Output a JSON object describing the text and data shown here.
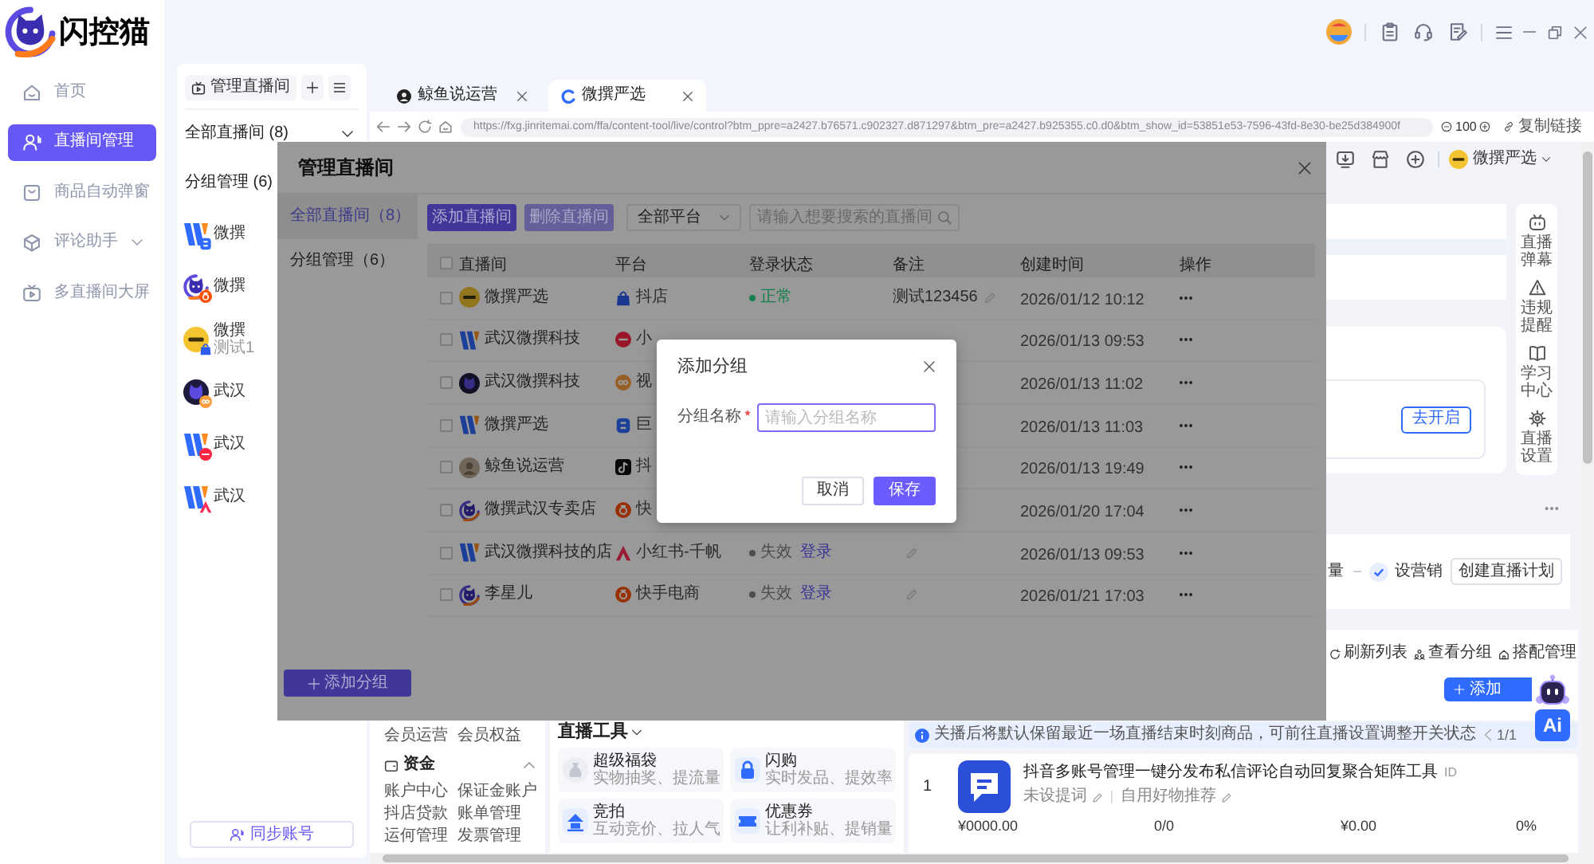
{
  "app": {
    "name": "闪控猫"
  },
  "nav": [
    {
      "label": "首页",
      "kind": "home",
      "selected": false
    },
    {
      "label": "直播间管理",
      "kind": "user",
      "selected": true
    },
    {
      "label": "商品自动弹窗",
      "kind": "box",
      "selected": false
    },
    {
      "label": "评论助手",
      "kind": "cube",
      "selected": false,
      "expandable": true
    },
    {
      "label": "多直播间大屏",
      "kind": "tv",
      "selected": false
    }
  ],
  "panel": {
    "manage_button": "管理直播间",
    "filters": [
      {
        "label": "全部直播间 (8)",
        "expandable": true
      },
      {
        "label": "分组管理 (6)"
      }
    ],
    "accounts": [
      {
        "name": "微撰",
        "avatar": {
          "kind": "stripes"
        },
        "platform": {
          "kind": "letter"
        }
      },
      {
        "name": "微撰",
        "avatar": {
          "kind": "logo"
        },
        "platform": {
          "kind": "camera"
        }
      },
      {
        "name": "微撰",
        "note": "测试1",
        "avatar": {
          "kind": "badge"
        },
        "platform": {
          "kind": "bag"
        }
      },
      {
        "name": "武汉",
        "avatar": {
          "kind": "cat"
        },
        "platform": {
          "kind": "knot"
        }
      },
      {
        "name": "武汉",
        "avatar": {
          "kind": "stripes"
        },
        "platform": {
          "kind": "disc"
        }
      },
      {
        "name": "武汉",
        "avatar": {
          "kind": "stripes"
        },
        "platform": {
          "kind": "peak"
        }
      }
    ],
    "sync_button": "同步账号"
  },
  "browser": {
    "tabs": [
      {
        "label": "鲸鱼说运营",
        "favicon": {
          "kind": "avatar"
        },
        "selected": false
      },
      {
        "label": "微撰严选",
        "favicon": {
          "kind": "swirl"
        },
        "selected": true
      }
    ],
    "url": "https://fxg.jinritemai.com/ffa/content-tool/live/control?btm_ppre=a2427.b76571.c902327.d871297&btm_pre=a2427.b925355.c0.d0&btm_show_id=53851e53-7596-43fd-8e30-be25d384900f",
    "zoom": "100",
    "copy_link": "复制链接"
  },
  "live_page": {
    "shop_name": "微撰严选",
    "side_tools": [
      {
        "label": "直播弹幕",
        "kind": "screen"
      },
      {
        "label": "违规提醒",
        "kind": "warning"
      },
      {
        "label": "学习中心",
        "kind": "book"
      },
      {
        "label": "直播设置",
        "kind": "gear"
      }
    ],
    "enable_button": "去开启",
    "plan_bar": {
      "steps": [
        {
          "label": "量",
          "done": false
        },
        {
          "label": "设营销",
          "done": true
        }
      ],
      "create_button": "创建直播计划"
    },
    "list_actions": [
      {
        "label": "刷新列表",
        "kind": "refresh"
      },
      {
        "label": "查看分组",
        "kind": "people"
      },
      {
        "label": "搭配管理",
        "kind": "house"
      }
    ],
    "add_button": "添加",
    "assistant": "Ai",
    "menu": {
      "rows": [
        [
          "会员运营",
          "会员权益"
        ]
      ],
      "section": {
        "label": "资金",
        "expanded": true
      },
      "links": [
        [
          "账户中心",
          "保证金账户"
        ],
        [
          "抖店贷款",
          "账单管理"
        ],
        [
          "运何管理",
          "发票管理"
        ]
      ]
    },
    "tools": {
      "title": "直播工具",
      "cards": [
        {
          "title": "超级福袋",
          "description": "实物抽奖、提流量",
          "kind": "pouch"
        },
        {
          "title": "闪购",
          "description": "实时发品、提效率",
          "kind": "lock"
        },
        {
          "title": "竞拍",
          "description": "互动竞价、拉人气",
          "kind": "house"
        },
        {
          "title": "优惠券",
          "description": "让利补贴、提销量",
          "kind": "ticket"
        }
      ]
    },
    "products": {
      "notice": "关播后将默认保留最近一场直播结束时刻商品，可前往直播设置调整开关状态",
      "pager": "1/1",
      "items": [
        {
          "index": "1",
          "title": "抖音多账号管理一键分发布私信评论自动回复聚合矩阵工具",
          "id_label": "ID",
          "tags": [
            "未设提词",
            "自用好物推荐"
          ],
          "stats": [
            "¥0000.00",
            "0/0",
            "¥0.00",
            "0%"
          ]
        }
      ]
    }
  },
  "manage_dialog": {
    "title": "管理直播间",
    "side": [
      {
        "label": "全部直播间（8）",
        "selected": true
      },
      {
        "label": "分组管理（6）",
        "selected": false
      }
    ],
    "add_group_button": "添加分组",
    "add_button": "添加直播间",
    "delete_button": {
      "label": "删除直播间",
      "disabled": true
    },
    "platform_select": "全部平台",
    "search": {
      "placeholder": "请输入想要搜索的直播间"
    },
    "table": {
      "all_checked": false,
      "columns": [
        "直播间",
        "平台",
        "登录状态",
        "备注",
        "创建时间",
        "操作"
      ],
      "rows": [
        {
          "checked": false,
          "avatar": {
            "kind": "badge"
          },
          "name": "微撰严选",
          "platform": {
            "kind": "bag",
            "label": "抖店"
          },
          "status": {
            "label": "正常",
            "color": "#17804c"
          },
          "remark": "测试123456",
          "editable": true,
          "created": "2026/01/12 10:12"
        },
        {
          "checked": false,
          "avatar": {
            "kind": "stripes"
          },
          "name": "武汉微撰科技",
          "platform": {
            "kind": "disc",
            "label": "小"
          },
          "created": "2026/01/13 09:53"
        },
        {
          "checked": false,
          "avatar": {
            "kind": "cat"
          },
          "name": "武汉微撰科技",
          "platform": {
            "kind": "knot",
            "label": "视"
          },
          "created": "2026/01/13 11:02"
        },
        {
          "checked": false,
          "avatar": {
            "kind": "stripes"
          },
          "name": "微撰严选",
          "platform": {
            "kind": "letter",
            "label": "巨"
          },
          "created": "2026/01/13 11:03"
        },
        {
          "checked": false,
          "avatar": {
            "kind": "photo"
          },
          "name": "鲸鱼说运营",
          "platform": {
            "kind": "note",
            "label": "抖"
          },
          "created": "2026/01/13 19:49"
        },
        {
          "checked": false,
          "avatar": {
            "kind": "logo"
          },
          "name": "微撰武汉专卖店",
          "platform": {
            "kind": "camera",
            "label": "快"
          },
          "created": "2026/01/20 17:04"
        },
        {
          "checked": false,
          "avatar": {
            "kind": "stripes"
          },
          "name": "武汉微撰科技的店",
          "platform": {
            "kind": "peak",
            "label": "小红书-千帆"
          },
          "status": {
            "label": "失效",
            "color": "#4d4d4d"
          },
          "login_link": "登录",
          "editable": true,
          "created": "2026/01/13 09:53"
        },
        {
          "checked": false,
          "avatar": {
            "kind": "logo"
          },
          "name": "李星儿",
          "platform": {
            "kind": "camera",
            "label": "快手电商"
          },
          "status": {
            "label": "失效",
            "color": "#4d4d4d"
          },
          "login_link": "登录",
          "editable": true,
          "created": "2026/01/21 17:03"
        }
      ]
    }
  },
  "group_dialog": {
    "title": "添加分组",
    "field": {
      "label": "分组名称",
      "required": true,
      "placeholder": "请输入分组名称",
      "focused": true
    },
    "cancel_button": "取消",
    "save_button": "保存"
  }
}
